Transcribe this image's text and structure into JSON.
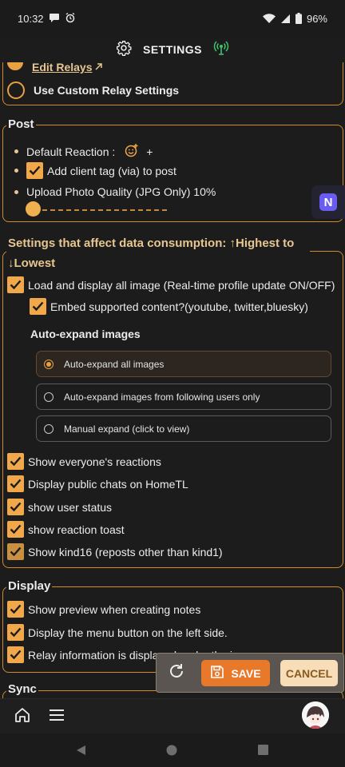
{
  "status_bar": {
    "time": "10:32",
    "battery": "96%"
  },
  "header": {
    "title": "SETTINGS"
  },
  "relays": {
    "edit_relays_label": "Edit Relays",
    "custom_relay_label": "Use Custom Relay Settings"
  },
  "post": {
    "section_title": "Post",
    "default_reaction_label": "Default Reaction :",
    "add_reaction_symbol": "+",
    "client_tag_label": "Add client tag (via) to post",
    "upload_quality_label": "Upload Photo Quality (JPG Only) 10%",
    "upload_quality_value": 0.1
  },
  "data_consumption": {
    "section_title_line1": "Settings that affect data consumption: ↑Highest to",
    "section_title_line2": "↓Lowest",
    "load_images_label": "Load and display all image (Real-time profile update ON/OFF)",
    "embed_label": "Embed supported content?(youtube, twitter,bluesky)",
    "auto_expand_title": "Auto-expand images",
    "auto_expand_options": [
      "Auto-expand all images",
      "Auto-expand images from following users only",
      "Manual expand (click to view)"
    ],
    "selected_option": "Auto-expand all images",
    "toggles": [
      "Show everyone's reactions",
      "Display public chats on HomeTL",
      "show user status",
      "show reaction toast",
      "Show kind16 (reposts other than kind1)"
    ]
  },
  "display": {
    "section_title": "Display",
    "toggles": [
      "Show preview when creating notes",
      "Display the menu button on the left side.",
      "Relay information is displayed under the icon."
    ]
  },
  "sync": {
    "section_title": "Sync"
  },
  "savebar": {
    "save_label": "SAVE",
    "cancel_label": "CANCEL"
  },
  "floating_app": {
    "letter": "N"
  },
  "colors": {
    "accent": "#f0a84a",
    "border": "#d08a2a",
    "background": "#1c1c1c",
    "save": "#e8782a",
    "cancel": "#f7ddb8"
  }
}
